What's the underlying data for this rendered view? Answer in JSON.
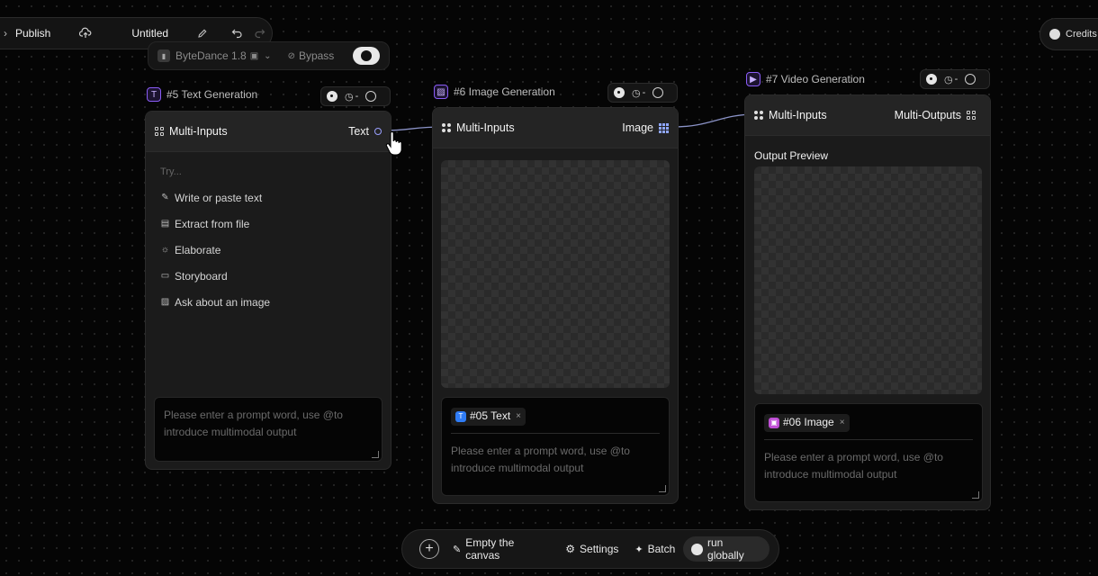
{
  "topbar": {
    "publish_label": "Publish",
    "title": "Untitled"
  },
  "model": {
    "name": "ByteDance 1.8",
    "bypass_label": "Bypass"
  },
  "credits": {
    "label": "Credits"
  },
  "nodes": [
    {
      "title": "#5 Text Generation",
      "badge": "T",
      "head_left": "Multi-Inputs",
      "head_right": "Text",
      "tool_value": "-",
      "menu": {
        "hint": "Try...",
        "items": [
          "Write or paste text",
          "Extract from file",
          "Elaborate",
          "Storyboard",
          "Ask about an image"
        ]
      },
      "prompt_placeholder": "Please enter a prompt word, use @to introduce multimodal output"
    },
    {
      "title": "#6 Image Generation",
      "head_left": "Multi-Inputs",
      "head_right": "Image",
      "tool_value": "-",
      "tag_label": "#05 Text",
      "tag_badge": "T",
      "prompt_placeholder": "Please enter a prompt word, use @to introduce multimodal output"
    },
    {
      "title": "#7 Video Generation",
      "head_left": "Multi-Inputs",
      "head_right": "Multi-Outputs",
      "tool_value": "-",
      "output_label": "Output Preview",
      "tag_label": "#06 Image",
      "prompt_placeholder": "Please enter a prompt word, use @to introduce multimodal output"
    }
  ],
  "bottombar": {
    "empty_label": "Empty the canvas",
    "settings_label": "Settings",
    "batch_label": "Batch",
    "run_label": "run globally"
  },
  "colors": {
    "accent_purple": "#8a5cf6",
    "tag_blue": "#2f7cf6",
    "tag_pink": "#c04fd6",
    "port_blue": "#9aa0ff"
  }
}
